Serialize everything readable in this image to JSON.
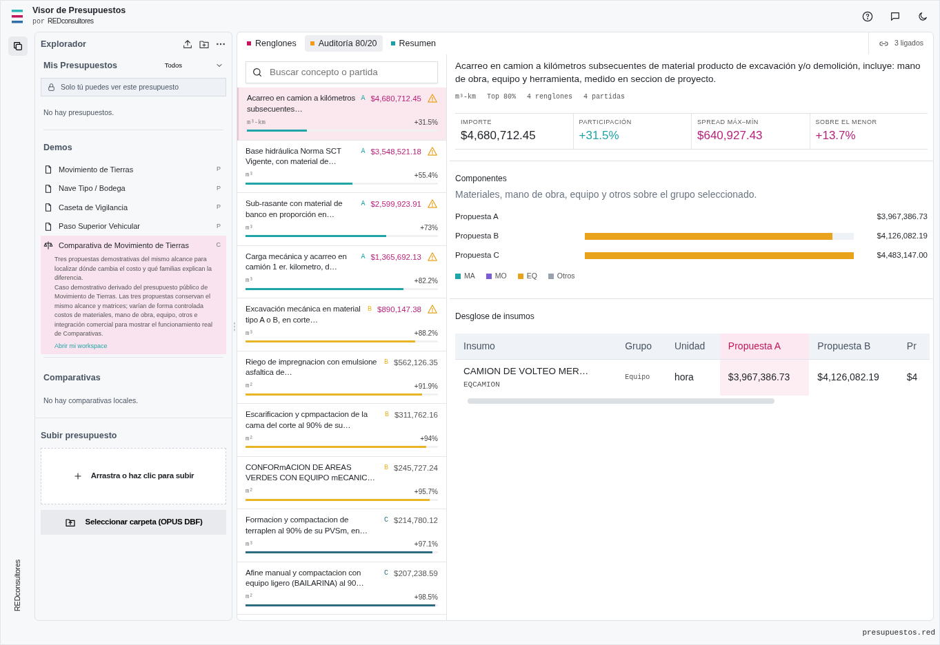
{
  "app": {
    "title": "Visor de Presupuestos",
    "byline": "por",
    "brand": "REDconsultores"
  },
  "side_brand": "REDconsultores",
  "explorer": {
    "title": "Explorador",
    "my_budgets": {
      "title": "Mis Presupuestos",
      "filter": "Todos",
      "notice": "Solo tú puedes ver este presupuesto",
      "empty": "No hay presupuestos."
    },
    "demos": {
      "title": "Demos",
      "items": [
        {
          "label": "Movimiento de Tierras",
          "kind": "document",
          "badge": "P",
          "selected": false
        },
        {
          "label": "Nave Tipo / Bodega",
          "kind": "document",
          "badge": "P",
          "selected": false
        },
        {
          "label": "Caseta de Vigilancia",
          "kind": "document",
          "badge": "P",
          "selected": false
        },
        {
          "label": "Paso Superior Vehicular",
          "kind": "document",
          "badge": "P",
          "selected": false
        },
        {
          "label": "Comparativa de Movimiento de Tierras",
          "kind": "comparison",
          "badge": "C",
          "selected": true,
          "description": [
            "Tres propuestas demostrativas del mismo alcance para localizar dónde cambia el costo y qué familias explican la diferencia.",
            "Caso demostrativo derivado del presupuesto público de Movimiento de Tierras. Las tres propuestas conservan el mismo alcance y matrices; varían de forma controlada costos de materiales, mano de obra, equipo, otros e integración comercial para mostrar el funcionamiento real de Comparativas."
          ],
          "link": "Abrir mi workspace"
        }
      ]
    },
    "comparisons": {
      "title": "Comparativas",
      "empty": "No hay comparativas locales."
    },
    "upload": {
      "title": "Subir presupuesto",
      "dropzone": "Arrastra o haz clic para subir",
      "folder_button": "Seleccionar carpeta (OPUS DBF)"
    }
  },
  "tabs": [
    {
      "label": "Renglones",
      "color": "#c2185b",
      "selected": false
    },
    {
      "label": "Auditoría 80/20",
      "color": "#f29b1d",
      "selected": true
    },
    {
      "label": "Resumen",
      "color": "#17a2a8",
      "selected": false
    }
  ],
  "linked": {
    "count": "3",
    "label": "ligados"
  },
  "search": {
    "placeholder": "Buscar concepto o partida"
  },
  "items": [
    {
      "description": "Acarreo en camion a kilómetros subsecuentes…",
      "group": "A",
      "color": "#1fa5a8",
      "amount": "$4,680,712.45",
      "flagged": true,
      "unit": "m³-km",
      "share": "+31.5%",
      "level": 0.315,
      "selected": true
    },
    {
      "description": "Base hidráulica Norma SCT Vigente, con material de…",
      "group": "A",
      "color": "#1fa5a8",
      "amount": "$3,548,521.18",
      "flagged": true,
      "unit": "m³",
      "share": "+55.4%",
      "level": 0.554,
      "selected": false
    },
    {
      "description": "Sub-rasante con material de banco en proporción en…",
      "group": "A",
      "color": "#1fa5a8",
      "amount": "$2,599,923.91",
      "flagged": true,
      "unit": "m³",
      "share": "+73%",
      "level": 0.73,
      "selected": false
    },
    {
      "description": "Carga mecánica y acarreo en camión 1 er. kilometro, d…",
      "group": "A",
      "color": "#1fa5a8",
      "amount": "$1,365,692.13",
      "flagged": true,
      "unit": "m³",
      "share": "+82.2%",
      "level": 0.822,
      "selected": false
    },
    {
      "description": "Excavación mecánica en material tipo A o B, en corte…",
      "group": "B",
      "color": "#e9b526",
      "amount": "$890,147.38",
      "flagged": true,
      "unit": "m³",
      "share": "+88.2%",
      "level": 0.882,
      "selected": false
    },
    {
      "description": "Riego de impregnacion con emulsione asfaltica de…",
      "group": "B",
      "color": "#e9b526",
      "amount": "$562,126.35",
      "flagged": false,
      "unit": "m²",
      "share": "+91.9%",
      "level": 0.919,
      "selected": false
    },
    {
      "description": "Escarificacion y cpmpactacion de la cama del corte al 90% de su…",
      "group": "B",
      "color": "#e9b526",
      "amount": "$311,762.16",
      "flagged": false,
      "unit": "m²",
      "share": "+94%",
      "level": 0.94,
      "selected": false
    },
    {
      "description": "CONFORmACION DE AREAS VERDES CON EQUIPO mECANIC…",
      "group": "B",
      "color": "#e9b526",
      "amount": "$245,727.24",
      "flagged": false,
      "unit": "m²",
      "share": "+95.7%",
      "level": 0.957,
      "selected": false
    },
    {
      "description": "Formacion y compactacion de terraplen al 90% de su PVSm, en…",
      "group": "C",
      "color": "#2d6b80",
      "amount": "$214,780.12",
      "flagged": false,
      "unit": "m³",
      "share": "+97.1%",
      "level": 0.971,
      "selected": false
    },
    {
      "description": "Afine manual y compactacion con equipo ligero (BAILARINA) al 90…",
      "group": "C",
      "color": "#2d6b80",
      "amount": "$207,238.59",
      "flagged": false,
      "unit": "m²",
      "share": "+98.5%",
      "level": 0.985,
      "selected": false
    }
  ],
  "detail": {
    "title": "Acarreo en camion a kilómetros subsecuentes de material producto de excavación y/o demolición, incluye: mano de obra, equipo y herramienta, medido en seccion de proyecto.",
    "meta": [
      "m³-km",
      "Top 80%",
      "4 renglones",
      "4 partidas"
    ],
    "stats": [
      {
        "label": "IMPORTE",
        "value": "$4,680,712.45",
        "color": "#1f2328"
      },
      {
        "label": "PARTICIPACIÓN",
        "value": "+31.5%",
        "color": "#1fa5a8"
      },
      {
        "label": "SPREAD MÁX–MÍN",
        "value": "$640,927.43",
        "color": "#b8237a"
      },
      {
        "label": "SOBRE EL MENOR",
        "value": "+13.7%",
        "color": "#b8237a"
      }
    ],
    "components": {
      "title": "Componentes",
      "subtitle": "Materiales, mano de obra, equipo y otros sobre el grupo seleccionado.",
      "rows": [
        {
          "label": "Propuesta A",
          "total": "$3,967,386.73"
        },
        {
          "label": "Propuesta B",
          "level": 0.92,
          "total": "$4,126,082.19"
        },
        {
          "label": "Propuesta C",
          "level": 1,
          "total": "$4,483,147.00"
        }
      ],
      "legend": [
        {
          "label": "MA",
          "color": "#1fa5a8"
        },
        {
          "label": "MO",
          "color": "#7b5bd6"
        },
        {
          "label": "EQ",
          "color": "#e9a21b"
        },
        {
          "label": "Otros",
          "color": "#9aa3ad"
        }
      ]
    },
    "breakdown": {
      "title": "Desglose de insumos",
      "columns": [
        {
          "label": "Insumo",
          "selected": false
        },
        {
          "label": "Grupo",
          "selected": false
        },
        {
          "label": "Unidad",
          "selected": false
        },
        {
          "label": "Propuesta A",
          "selected": true
        },
        {
          "label": "Propuesta B",
          "selected": false
        },
        {
          "label": "Pr",
          "selected": false
        }
      ],
      "rows": [
        {
          "name": "CAMION DE VOLTEO MER…",
          "code": "EQCAMION",
          "group": "Equipo",
          "unit": "hora",
          "values": [
            "$3,967,386.73",
            "$4,126,082.19",
            "$4"
          ]
        }
      ]
    }
  },
  "footer": "presupuestos.red"
}
